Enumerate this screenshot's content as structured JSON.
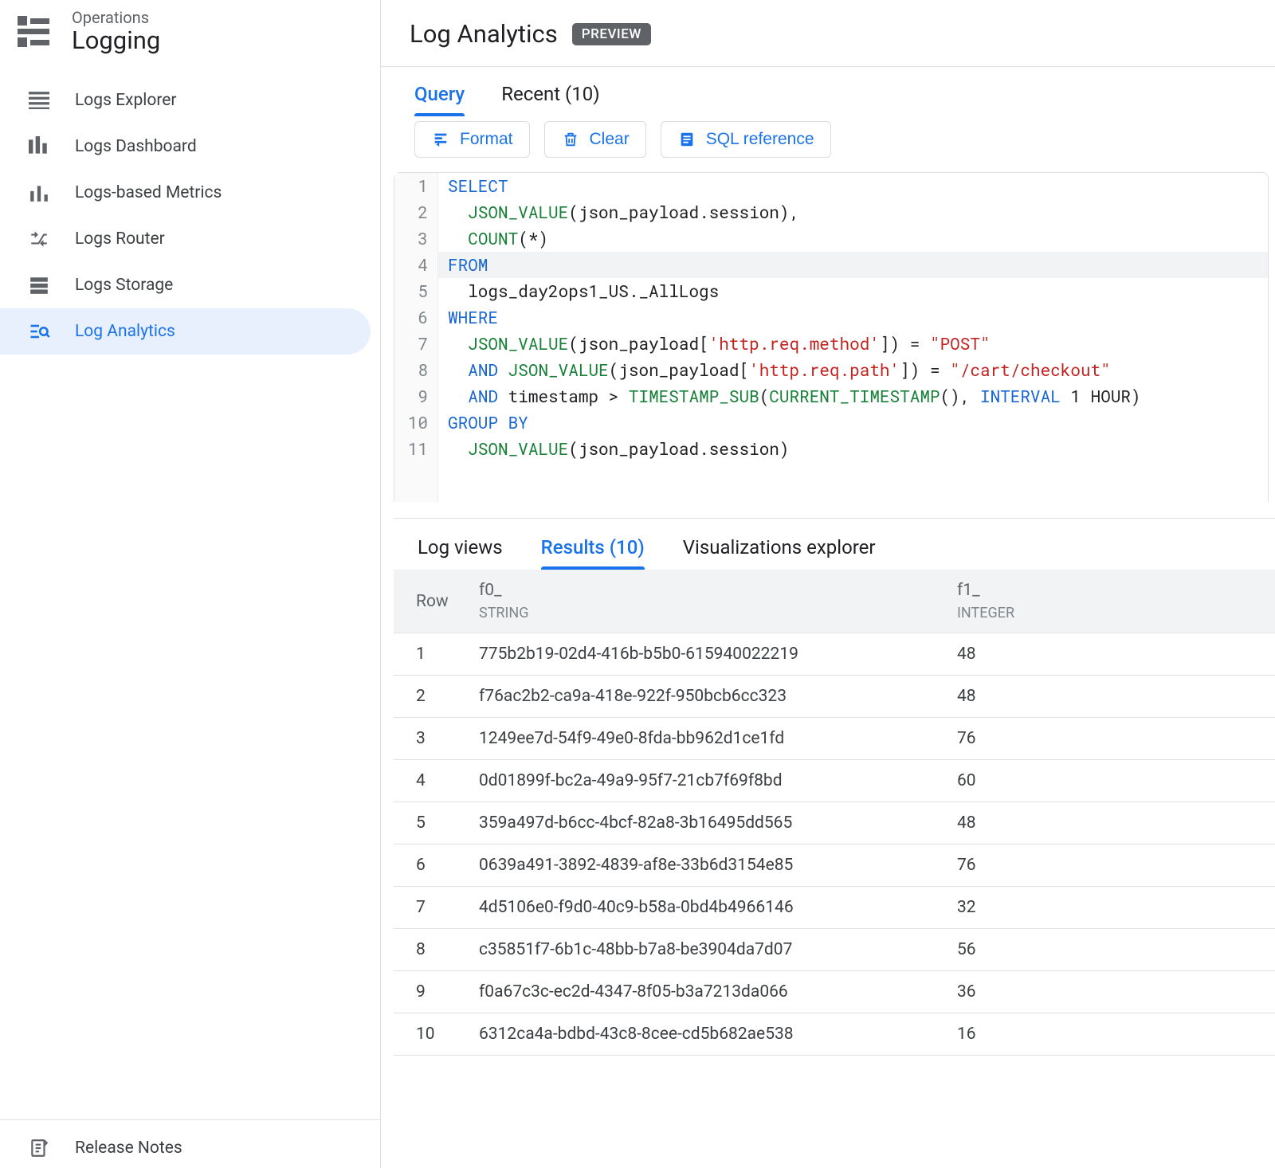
{
  "sidebar": {
    "product_line": "Operations",
    "product_name": "Logging",
    "items": [
      {
        "label": "Logs Explorer"
      },
      {
        "label": "Logs Dashboard"
      },
      {
        "label": "Logs-based Metrics"
      },
      {
        "label": "Logs Router"
      },
      {
        "label": "Logs Storage"
      },
      {
        "label": "Log Analytics"
      }
    ],
    "footer": {
      "label": "Release Notes"
    }
  },
  "header": {
    "title": "Log Analytics",
    "badge": "PREVIEW"
  },
  "query_tabs": {
    "query": "Query",
    "recent": "Recent (10)"
  },
  "actions": {
    "format": "Format",
    "clear": "Clear",
    "sql_reference": "SQL reference"
  },
  "sql": {
    "lines": [
      "SELECT",
      "  JSON_VALUE(json_payload.session),",
      "  COUNT(*)",
      "FROM",
      "  logs_day2ops1_US._AllLogs",
      "WHERE",
      "  JSON_VALUE(json_payload['http.req.method']) = \"POST\"",
      "  AND JSON_VALUE(json_payload['http.req.path']) = \"/cart/checkout\"",
      "  AND timestamp > TIMESTAMP_SUB(CURRENT_TIMESTAMP(), INTERVAL 1 HOUR)",
      "GROUP BY",
      "  JSON_VALUE(json_payload.session)"
    ]
  },
  "results_tabs": {
    "log_views": "Log views",
    "results": "Results (10)",
    "viz": "Visualizations explorer"
  },
  "results": {
    "headers": {
      "row": "Row",
      "f0": "f0_",
      "f0_type": "STRING",
      "f1": "f1_",
      "f1_type": "INTEGER"
    },
    "rows": [
      {
        "n": "1",
        "f0": "775b2b19-02d4-416b-b5b0-615940022219",
        "f1": "48"
      },
      {
        "n": "2",
        "f0": "f76ac2b2-ca9a-418e-922f-950bcb6cc323",
        "f1": "48"
      },
      {
        "n": "3",
        "f0": "1249ee7d-54f9-49e0-8fda-bb962d1ce1fd",
        "f1": "76"
      },
      {
        "n": "4",
        "f0": "0d01899f-bc2a-49a9-95f7-21cb7f69f8bd",
        "f1": "60"
      },
      {
        "n": "5",
        "f0": "359a497d-b6cc-4bcf-82a8-3b16495dd565",
        "f1": "48"
      },
      {
        "n": "6",
        "f0": "0639a491-3892-4839-af8e-33b6d3154e85",
        "f1": "76"
      },
      {
        "n": "7",
        "f0": "4d5106e0-f9d0-40c9-b58a-0bd4b4966146",
        "f1": "32"
      },
      {
        "n": "8",
        "f0": "c35851f7-6b1c-48bb-b7a8-be3904da7d07",
        "f1": "56"
      },
      {
        "n": "9",
        "f0": "f0a67c3c-ec2d-4347-8f05-b3a7213da066",
        "f1": "36"
      },
      {
        "n": "10",
        "f0": "6312ca4a-bdbd-43c8-8cee-cd5b682ae538",
        "f1": "16"
      }
    ]
  }
}
